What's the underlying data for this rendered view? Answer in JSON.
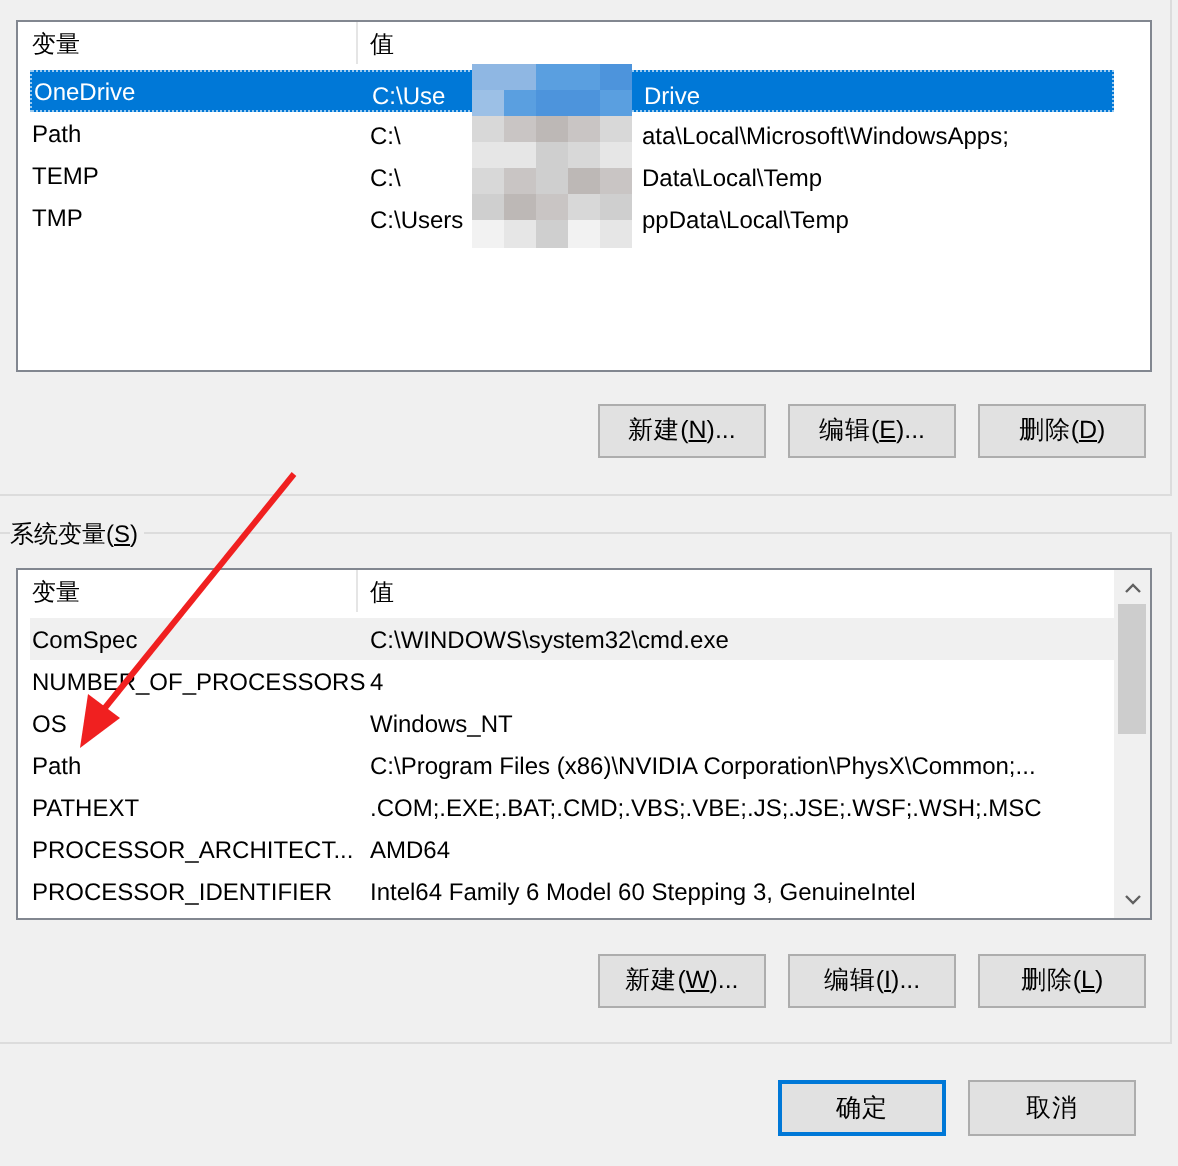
{
  "user_variables": {
    "focused": true,
    "columns": [
      "变量",
      "值"
    ],
    "rows": [
      {
        "name": "OneDrive",
        "value_start": "C:\\Use",
        "value_end": "Drive",
        "selected": true
      },
      {
        "name": "Path",
        "value_start": "C:\\",
        "value_end": "ata\\Local\\Microsoft\\WindowsApps;",
        "selected": false
      },
      {
        "name": "TEMP",
        "value_start": "C:\\",
        "value_end": "Data\\Local\\Temp",
        "selected": false
      },
      {
        "name": "TMP",
        "value_start": "C:\\Users",
        "value_end": "ppData\\Local\\Temp",
        "selected": false
      }
    ],
    "buttons": [
      {
        "pre": "新建(",
        "key": "N",
        "post": ")..."
      },
      {
        "pre": "编辑(",
        "key": "E",
        "post": ")..."
      },
      {
        "pre": "删除(",
        "key": "D",
        "post": ")"
      }
    ]
  },
  "system_variables": {
    "title_pre": "系统变量(",
    "title_key": "S",
    "title_post": ")",
    "focused": false,
    "columns": [
      "变量",
      "值"
    ],
    "rows": [
      {
        "name": "ComSpec",
        "value": "C:\\WINDOWS\\system32\\cmd.exe",
        "selected": true
      },
      {
        "name": "NUMBER_OF_PROCESSORS",
        "value": "4",
        "selected": false
      },
      {
        "name": "OS",
        "value": "Windows_NT",
        "selected": false
      },
      {
        "name": "Path",
        "value": "C:\\Program Files (x86)\\NVIDIA Corporation\\PhysX\\Common;...",
        "selected": false
      },
      {
        "name": "PATHEXT",
        "value": ".COM;.EXE;.BAT;.CMD;.VBS;.VBE;.JS;.JSE;.WSF;.WSH;.MSC",
        "selected": false
      },
      {
        "name": "PROCESSOR_ARCHITECT...",
        "value": "AMD64",
        "selected": false
      },
      {
        "name": "PROCESSOR_IDENTIFIER",
        "value": "Intel64 Family 6 Model 60 Stepping 3, GenuineIntel",
        "selected": false
      }
    ],
    "buttons": [
      {
        "pre": "新建(",
        "key": "W",
        "post": ")..."
      },
      {
        "pre": "编辑(",
        "key": "I",
        "post": ")..."
      },
      {
        "pre": "删除(",
        "key": "L",
        "post": ")"
      }
    ]
  },
  "dialog_buttons": [
    {
      "label": "确定",
      "default": true
    },
    {
      "label": "取消",
      "default": false
    }
  ]
}
